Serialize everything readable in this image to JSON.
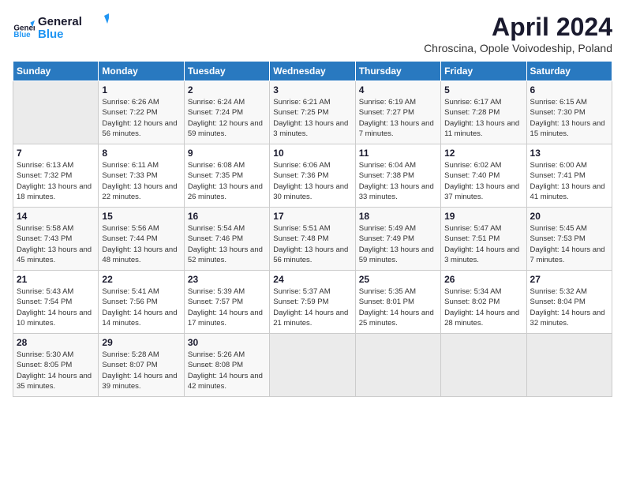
{
  "logo": {
    "line1": "General",
    "line2": "Blue"
  },
  "title": "April 2024",
  "subtitle": "Chroscina, Opole Voivodeship, Poland",
  "weekdays": [
    "Sunday",
    "Monday",
    "Tuesday",
    "Wednesday",
    "Thursday",
    "Friday",
    "Saturday"
  ],
  "weeks": [
    [
      {
        "day": "",
        "sunrise": "",
        "sunset": "",
        "daylight": ""
      },
      {
        "day": "1",
        "sunrise": "6:26 AM",
        "sunset": "7:22 PM",
        "daylight": "12 hours and 56 minutes."
      },
      {
        "day": "2",
        "sunrise": "6:24 AM",
        "sunset": "7:24 PM",
        "daylight": "12 hours and 59 minutes."
      },
      {
        "day": "3",
        "sunrise": "6:21 AM",
        "sunset": "7:25 PM",
        "daylight": "13 hours and 3 minutes."
      },
      {
        "day": "4",
        "sunrise": "6:19 AM",
        "sunset": "7:27 PM",
        "daylight": "13 hours and 7 minutes."
      },
      {
        "day": "5",
        "sunrise": "6:17 AM",
        "sunset": "7:28 PM",
        "daylight": "13 hours and 11 minutes."
      },
      {
        "day": "6",
        "sunrise": "6:15 AM",
        "sunset": "7:30 PM",
        "daylight": "13 hours and 15 minutes."
      }
    ],
    [
      {
        "day": "7",
        "sunrise": "6:13 AM",
        "sunset": "7:32 PM",
        "daylight": "13 hours and 18 minutes."
      },
      {
        "day": "8",
        "sunrise": "6:11 AM",
        "sunset": "7:33 PM",
        "daylight": "13 hours and 22 minutes."
      },
      {
        "day": "9",
        "sunrise": "6:08 AM",
        "sunset": "7:35 PM",
        "daylight": "13 hours and 26 minutes."
      },
      {
        "day": "10",
        "sunrise": "6:06 AM",
        "sunset": "7:36 PM",
        "daylight": "13 hours and 30 minutes."
      },
      {
        "day": "11",
        "sunrise": "6:04 AM",
        "sunset": "7:38 PM",
        "daylight": "13 hours and 33 minutes."
      },
      {
        "day": "12",
        "sunrise": "6:02 AM",
        "sunset": "7:40 PM",
        "daylight": "13 hours and 37 minutes."
      },
      {
        "day": "13",
        "sunrise": "6:00 AM",
        "sunset": "7:41 PM",
        "daylight": "13 hours and 41 minutes."
      }
    ],
    [
      {
        "day": "14",
        "sunrise": "5:58 AM",
        "sunset": "7:43 PM",
        "daylight": "13 hours and 45 minutes."
      },
      {
        "day": "15",
        "sunrise": "5:56 AM",
        "sunset": "7:44 PM",
        "daylight": "13 hours and 48 minutes."
      },
      {
        "day": "16",
        "sunrise": "5:54 AM",
        "sunset": "7:46 PM",
        "daylight": "13 hours and 52 minutes."
      },
      {
        "day": "17",
        "sunrise": "5:51 AM",
        "sunset": "7:48 PM",
        "daylight": "13 hours and 56 minutes."
      },
      {
        "day": "18",
        "sunrise": "5:49 AM",
        "sunset": "7:49 PM",
        "daylight": "13 hours and 59 minutes."
      },
      {
        "day": "19",
        "sunrise": "5:47 AM",
        "sunset": "7:51 PM",
        "daylight": "14 hours and 3 minutes."
      },
      {
        "day": "20",
        "sunrise": "5:45 AM",
        "sunset": "7:53 PM",
        "daylight": "14 hours and 7 minutes."
      }
    ],
    [
      {
        "day": "21",
        "sunrise": "5:43 AM",
        "sunset": "7:54 PM",
        "daylight": "14 hours and 10 minutes."
      },
      {
        "day": "22",
        "sunrise": "5:41 AM",
        "sunset": "7:56 PM",
        "daylight": "14 hours and 14 minutes."
      },
      {
        "day": "23",
        "sunrise": "5:39 AM",
        "sunset": "7:57 PM",
        "daylight": "14 hours and 17 minutes."
      },
      {
        "day": "24",
        "sunrise": "5:37 AM",
        "sunset": "7:59 PM",
        "daylight": "14 hours and 21 minutes."
      },
      {
        "day": "25",
        "sunrise": "5:35 AM",
        "sunset": "8:01 PM",
        "daylight": "14 hours and 25 minutes."
      },
      {
        "day": "26",
        "sunrise": "5:34 AM",
        "sunset": "8:02 PM",
        "daylight": "14 hours and 28 minutes."
      },
      {
        "day": "27",
        "sunrise": "5:32 AM",
        "sunset": "8:04 PM",
        "daylight": "14 hours and 32 minutes."
      }
    ],
    [
      {
        "day": "28",
        "sunrise": "5:30 AM",
        "sunset": "8:05 PM",
        "daylight": "14 hours and 35 minutes."
      },
      {
        "day": "29",
        "sunrise": "5:28 AM",
        "sunset": "8:07 PM",
        "daylight": "14 hours and 39 minutes."
      },
      {
        "day": "30",
        "sunrise": "5:26 AM",
        "sunset": "8:08 PM",
        "daylight": "14 hours and 42 minutes."
      },
      {
        "day": "",
        "sunrise": "",
        "sunset": "",
        "daylight": ""
      },
      {
        "day": "",
        "sunrise": "",
        "sunset": "",
        "daylight": ""
      },
      {
        "day": "",
        "sunrise": "",
        "sunset": "",
        "daylight": ""
      },
      {
        "day": "",
        "sunrise": "",
        "sunset": "",
        "daylight": ""
      }
    ]
  ]
}
